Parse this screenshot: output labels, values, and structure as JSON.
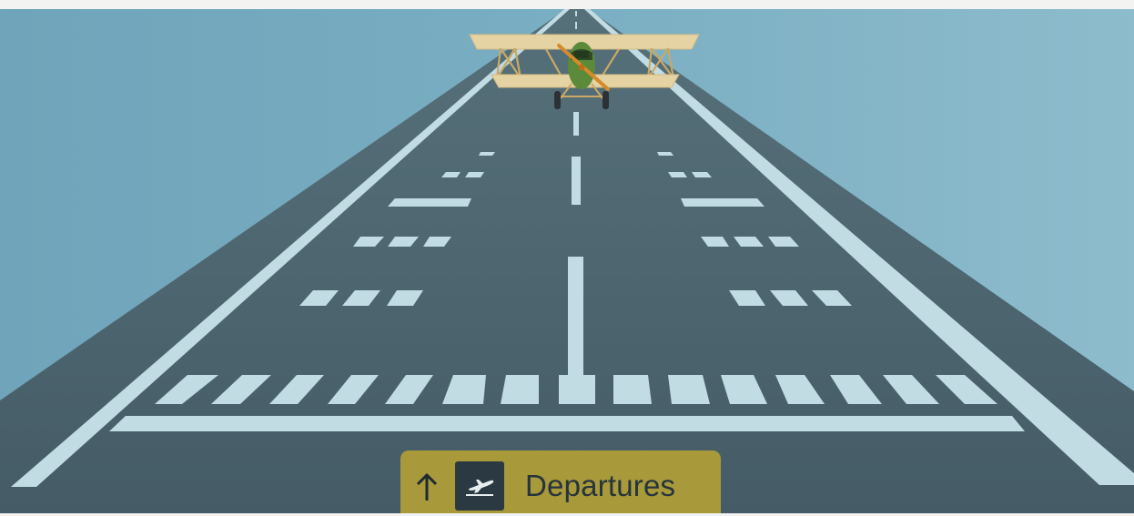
{
  "sign": {
    "direction_icon": "arrow-up-icon",
    "pictogram_icon": "departing-plane-icon",
    "label": "Departures"
  },
  "colors": {
    "sky": "#7fb0c4",
    "runway": "#4f6670",
    "markings": "#c2dce4",
    "sign_background": "#a8993a",
    "sign_icon_box": "#2b3a42",
    "sign_text": "#26343b",
    "aircraft_body": "#5a8a3a",
    "aircraft_wings": "#e6d3a3"
  }
}
